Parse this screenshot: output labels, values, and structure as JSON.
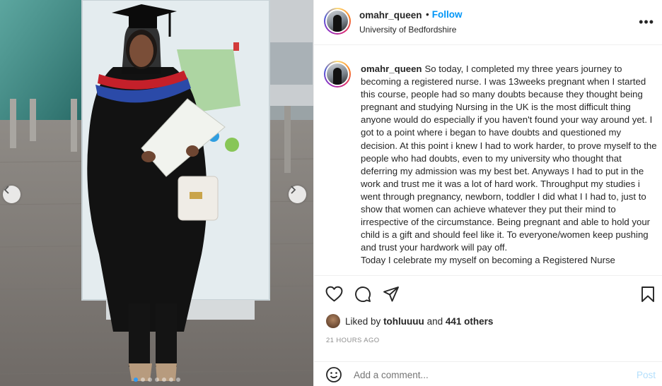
{
  "post": {
    "username": "omahr_queen",
    "bullet": "•",
    "follow_label": "Follow",
    "location": "University of Bedfordshire",
    "more_label": "•••",
    "caption_user": "omahr_queen",
    "caption_text": "So today, I completed my three years journey to becoming a registered nurse. I was 13weeks pregnant when I started this course, people had so many doubts because they thought being pregnant and studying Nursing in the UK is the most difficult thing anyone would do especially if you haven't found your way around yet. I got to a point where i began to have doubts and questioned my decision. At this point i knew I had to work harder, to prove myself to the people who had doubts, even to my university who thought that deferring my admission was my best bet. Anyways I had to put in the work and trust me it was a lot of hard work. Throughput my studies i went through pregnancy, newborn, toddler I did what I I had to, just to show that women can achieve whatever they put their mind to irrespective of the circumstance. Being pregnant and able to hold your child is a gift and should feel like it. To everyone/women keep pushing and trust your hardwork will pay off.",
    "caption_cutoff": "Today I celebrate my myself on becoming a Registered Nurse"
  },
  "likes": {
    "prefix": "Liked by ",
    "user": "tohluuuu",
    "middle": " and ",
    "others": "441 others"
  },
  "timestamp": "21 HOURS AGO",
  "comment": {
    "placeholder": "Add a comment...",
    "post_label": "Post"
  },
  "carousel": {
    "total_slides": 7,
    "active_slide": 1
  },
  "icons": {
    "emoji": "smiley-icon",
    "like": "heart-icon",
    "comment": "comment-icon",
    "share": "share-icon",
    "save": "bookmark-icon",
    "prev": "chevron-left-icon",
    "next": "chevron-right-icon"
  },
  "colors": {
    "follow": "#0095f6",
    "post_disabled": "#b3dffc",
    "muted": "#8e8e8e",
    "carousel_active": "#2f9bf6"
  }
}
